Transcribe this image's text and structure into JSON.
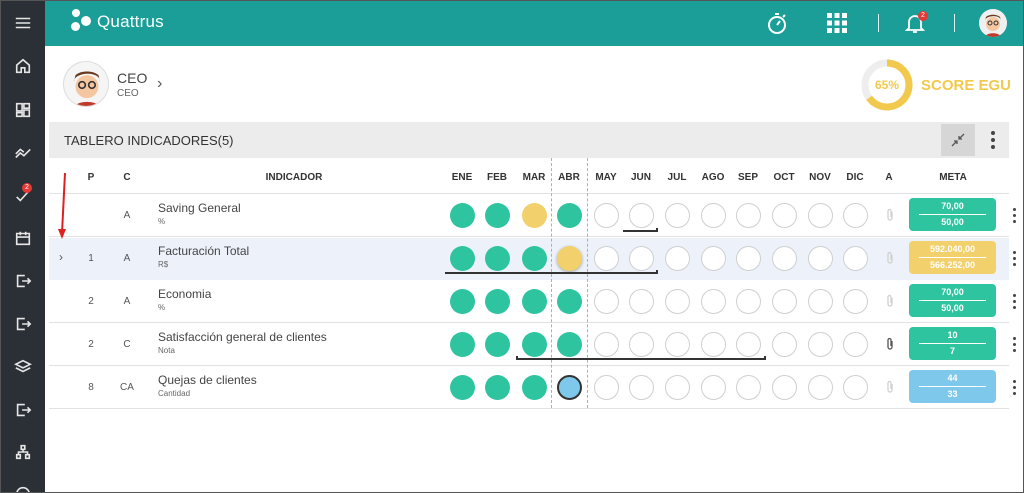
{
  "app": {
    "name": "Quattrus"
  },
  "topbar": {
    "notifications_count": "2"
  },
  "sidebar": {
    "badge_count": "2"
  },
  "profile": {
    "name": "CEO",
    "role": "CEO"
  },
  "score": {
    "value": "65%",
    "percent": 65,
    "label": "SCORE EGU",
    "color": "#f2c94c"
  },
  "panel": {
    "title": "TABLERO INDICADORES(5)"
  },
  "table": {
    "columns": {
      "p": "P",
      "c": "C",
      "indicador": "INDICADOR",
      "a": "A",
      "meta": "META"
    },
    "months": [
      "ENE",
      "FEB",
      "MAR",
      "ABR",
      "MAY",
      "JUN",
      "JUL",
      "AGO",
      "SEP",
      "OCT",
      "NOV",
      "DIC"
    ],
    "rows": [
      {
        "p": "",
        "c": "A",
        "name": "Saving General",
        "unit": "%",
        "months": [
          "green",
          "green",
          "yellow",
          "green",
          "empty",
          "empty",
          "empty",
          "empty",
          "empty",
          "empty",
          "empty",
          "empty"
        ],
        "meta_top": "70,00",
        "meta_bottom": "50,00",
        "meta_color": "#2ec4a0",
        "attachment": "light"
      },
      {
        "p": "1",
        "c": "A",
        "name": "Facturación Total",
        "unit": "R$",
        "months": [
          "green",
          "green",
          "green",
          "yellow",
          "empty",
          "empty",
          "empty",
          "empty",
          "empty",
          "empty",
          "empty",
          "empty"
        ],
        "meta_top": "592.040,00",
        "meta_bottom": "566.252,00",
        "meta_color": "#f2d06b",
        "attachment": "light"
      },
      {
        "p": "2",
        "c": "A",
        "name": "Economia",
        "unit": "%",
        "months": [
          "green",
          "green",
          "green",
          "green",
          "empty",
          "empty",
          "empty",
          "empty",
          "empty",
          "empty",
          "empty",
          "empty"
        ],
        "meta_top": "70,00",
        "meta_bottom": "50,00",
        "meta_color": "#2ec4a0",
        "attachment": "light"
      },
      {
        "p": "2",
        "c": "C",
        "name": "Satisfacción general de clientes",
        "unit": "Nota",
        "months": [
          "green",
          "green",
          "green",
          "green",
          "empty",
          "empty",
          "empty",
          "empty",
          "empty",
          "empty",
          "empty",
          "empty"
        ],
        "meta_top": "10",
        "meta_bottom": "7",
        "meta_color": "#2ec4a0",
        "attachment": "dark"
      },
      {
        "p": "8",
        "c": "CA",
        "name": "Quejas de clientes",
        "unit": "Cantidad",
        "months": [
          "green",
          "green",
          "green",
          "blue",
          "empty",
          "empty",
          "empty",
          "empty",
          "empty",
          "empty",
          "empty",
          "empty"
        ],
        "meta_top": "44",
        "meta_bottom": "33",
        "meta_color": "#7ec8ec",
        "attachment": "light"
      }
    ]
  },
  "colors": {
    "teal": "#1a9e97",
    "green": "#2ec4a0",
    "yellow": "#f2d06b",
    "blue": "#7ec8ec",
    "sidebar": "#2b2f36"
  }
}
